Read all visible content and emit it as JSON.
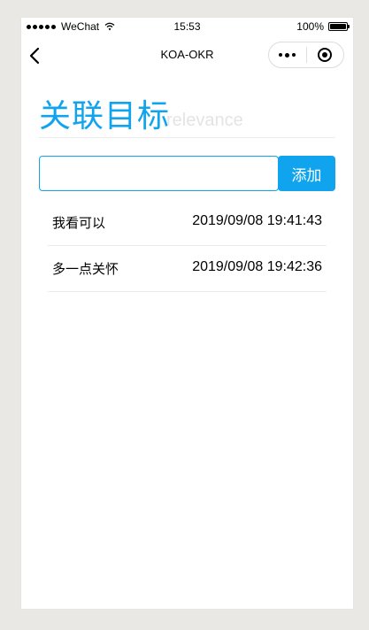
{
  "colors": {
    "accent": "#10a4ee",
    "background": "#e9e8e4"
  },
  "status_bar": {
    "carrier": "WeChat",
    "time": "15:53",
    "battery": "100%",
    "battery_level": 1.0
  },
  "nav": {
    "title": "KOA-OKR",
    "back_icon": "chevron-left-icon",
    "more_icon": "more-dots-icon",
    "close_icon": "target-circle-icon"
  },
  "heading": {
    "title": "关联目标",
    "subtitle": "relevance"
  },
  "add_form": {
    "input_value": "",
    "input_placeholder": "",
    "button_label": "添加"
  },
  "items": [
    {
      "text": "我看可以",
      "time": "2019/09/08 19:41:43"
    },
    {
      "text": "多一点关怀",
      "time": "2019/09/08 19:42:36"
    }
  ]
}
